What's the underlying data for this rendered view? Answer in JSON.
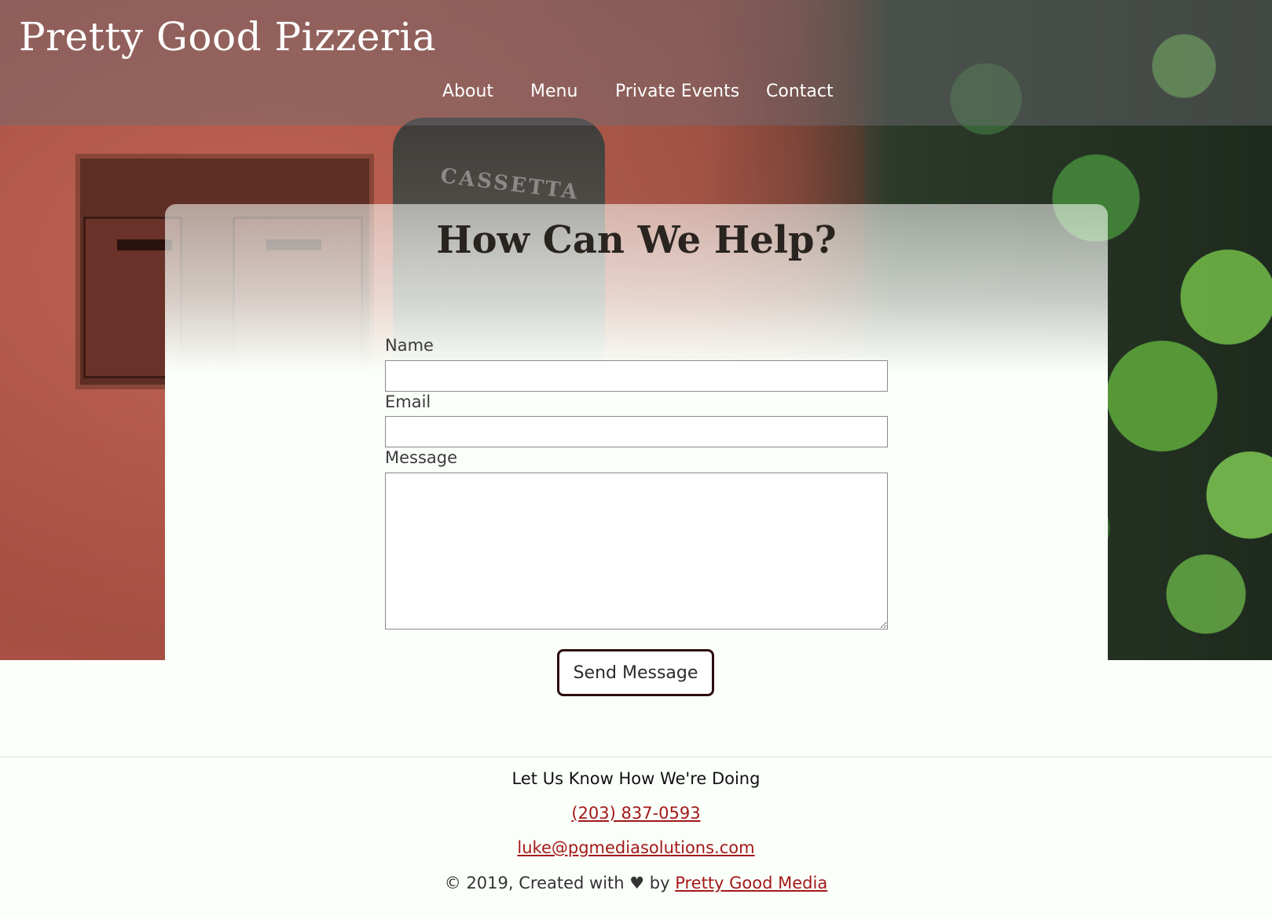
{
  "site": {
    "title": "Pretty Good Pizzeria"
  },
  "nav": {
    "items": [
      {
        "label": "About"
      },
      {
        "label": "Menu"
      },
      {
        "label": "Private Events"
      },
      {
        "label": "Contact"
      }
    ]
  },
  "hero": {
    "plaque_text": "CASSETTA"
  },
  "form": {
    "title": "How Can We Help?",
    "name_label": "Name",
    "name_value": "",
    "email_label": "Email",
    "email_value": "",
    "message_label": "Message",
    "message_value": "",
    "submit_label": "Send Message"
  },
  "footer": {
    "heading": "Let Us Know How We're Doing",
    "phone": "(203) 837-0593",
    "email": "luke@pgmediasolutions.com",
    "copyright_prefix": "© 2019, Created with ♥ by",
    "credit_link": "Pretty Good Media"
  },
  "colors": {
    "link": "#a31919",
    "button_border": "#2b0c0c",
    "page_bg": "#fbfffa"
  }
}
